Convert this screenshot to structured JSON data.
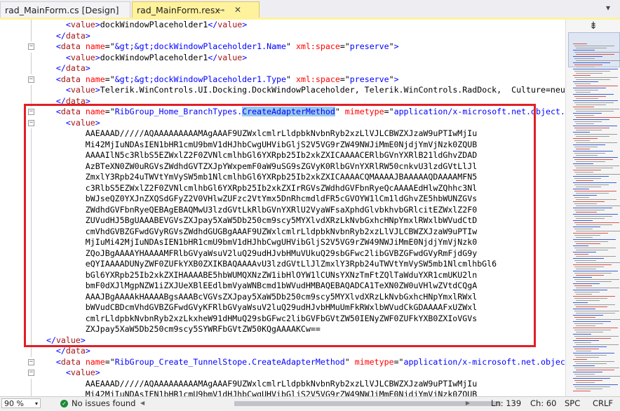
{
  "tabs": [
    {
      "label": "rad_MainForm.cs [Design]",
      "active": false
    },
    {
      "label": "rad_MainForm.resx",
      "active": true,
      "pin": "⊸",
      "close": "✕"
    }
  ],
  "tab_overflow": "▾",
  "colors": {
    "tag": "#0000ff",
    "element": "#a31515",
    "attr": "#ff0000",
    "text": "#000000",
    "highlight": "#e01f27",
    "selection": "#99c9ef",
    "active_tab": "#fff29d"
  },
  "code_lines": [
    {
      "fold": "line",
      "tokens": [
        {
          "t": "      ",
          "c": "k"
        },
        {
          "t": "<",
          "c": "b"
        },
        {
          "t": "value",
          "c": "r"
        },
        {
          "t": ">",
          "c": "b"
        },
        {
          "t": "dockWindowPlaceholder1",
          "c": "k"
        },
        {
          "t": "</",
          "c": "b"
        },
        {
          "t": "value",
          "c": "r"
        },
        {
          "t": ">",
          "c": "b"
        }
      ]
    },
    {
      "fold": "line",
      "tokens": [
        {
          "t": "    ",
          "c": "k"
        },
        {
          "t": "</",
          "c": "b"
        },
        {
          "t": "data",
          "c": "r"
        },
        {
          "t": ">",
          "c": "b"
        }
      ]
    },
    {
      "fold": "box",
      "tokens": [
        {
          "t": "    ",
          "c": "k"
        },
        {
          "t": "<",
          "c": "b"
        },
        {
          "t": "data",
          "c": "r"
        },
        {
          "t": " ",
          "c": "k"
        },
        {
          "t": "name",
          "c": "a"
        },
        {
          "t": "=\"",
          "c": "k"
        },
        {
          "t": "&gt;&gt;dockWindowPlaceholder1.Name",
          "c": "b"
        },
        {
          "t": "\"",
          "c": "k"
        },
        {
          "t": " ",
          "c": "k"
        },
        {
          "t": "xml:space",
          "c": "a"
        },
        {
          "t": "=\"",
          "c": "k"
        },
        {
          "t": "preserve",
          "c": "b"
        },
        {
          "t": "\"",
          "c": "k"
        },
        {
          "t": ">",
          "c": "b"
        }
      ]
    },
    {
      "fold": "line",
      "tokens": [
        {
          "t": "      ",
          "c": "k"
        },
        {
          "t": "<",
          "c": "b"
        },
        {
          "t": "value",
          "c": "r"
        },
        {
          "t": ">",
          "c": "b"
        },
        {
          "t": "dockWindowPlaceholder1",
          "c": "k"
        },
        {
          "t": "</",
          "c": "b"
        },
        {
          "t": "value",
          "c": "r"
        },
        {
          "t": ">",
          "c": "b"
        }
      ]
    },
    {
      "fold": "line",
      "tokens": [
        {
          "t": "    ",
          "c": "k"
        },
        {
          "t": "</",
          "c": "b"
        },
        {
          "t": "data",
          "c": "r"
        },
        {
          "t": ">",
          "c": "b"
        }
      ]
    },
    {
      "fold": "box",
      "tokens": [
        {
          "t": "    ",
          "c": "k"
        },
        {
          "t": "<",
          "c": "b"
        },
        {
          "t": "data",
          "c": "r"
        },
        {
          "t": " ",
          "c": "k"
        },
        {
          "t": "name",
          "c": "a"
        },
        {
          "t": "=\"",
          "c": "k"
        },
        {
          "t": "&gt;&gt;dockWindowPlaceholder1.Type",
          "c": "b"
        },
        {
          "t": "\"",
          "c": "k"
        },
        {
          "t": " ",
          "c": "k"
        },
        {
          "t": "xml:space",
          "c": "a"
        },
        {
          "t": "=\"",
          "c": "k"
        },
        {
          "t": "preserve",
          "c": "b"
        },
        {
          "t": "\"",
          "c": "k"
        },
        {
          "t": ">",
          "c": "b"
        }
      ]
    },
    {
      "fold": "line",
      "tokens": [
        {
          "t": "      ",
          "c": "k"
        },
        {
          "t": "<",
          "c": "b"
        },
        {
          "t": "value",
          "c": "r"
        },
        {
          "t": ">",
          "c": "b"
        },
        {
          "t": "Telerik.WinControls.UI.Docking.DockWindowPlaceholder, Telerik.WinControls.RadDock,  Culture=neutral",
          "c": "k"
        }
      ]
    },
    {
      "fold": "line",
      "tokens": [
        {
          "t": "    ",
          "c": "k"
        },
        {
          "t": "</",
          "c": "b"
        },
        {
          "t": "data",
          "c": "r"
        },
        {
          "t": ">",
          "c": "b"
        }
      ]
    },
    {
      "fold": "box",
      "tokens": [
        {
          "t": "    ",
          "c": "k"
        },
        {
          "t": "<",
          "c": "b"
        },
        {
          "t": "data",
          "c": "r"
        },
        {
          "t": " ",
          "c": "k"
        },
        {
          "t": "name",
          "c": "a"
        },
        {
          "t": "=\"",
          "c": "k"
        },
        {
          "t": "RibGroup_Home_BranchTypes.",
          "c": "b"
        },
        {
          "t": "CreateAdapterMethod",
          "c": "b",
          "sel": true
        },
        {
          "t": "\"",
          "c": "k"
        },
        {
          "t": " ",
          "c": "k"
        },
        {
          "t": "mimetype",
          "c": "a"
        },
        {
          "t": "=\"",
          "c": "k"
        },
        {
          "t": "application/x-microsoft.net.object.bina",
          "c": "b"
        }
      ]
    },
    {
      "fold": "box",
      "tokens": [
        {
          "t": "      ",
          "c": "k"
        },
        {
          "t": "<",
          "c": "b"
        },
        {
          "t": "value",
          "c": "r"
        },
        {
          "t": ">",
          "c": "b"
        }
      ]
    },
    {
      "fold": "line",
      "tokens": [
        {
          "t": "          AAEAAAD/////AQAAAAAAAAAMAgAAAF9UZWxlcmlrLldpbkNvbnRyb2xzLlVJLCBWZXJzaW9uPTIwMjIu",
          "c": "k"
        }
      ]
    },
    {
      "fold": "line",
      "tokens": [
        {
          "t": "          Mi42MjIuNDAsIEN1bHR1cmU9bmV1dHJhbCwgUHVibGljS2V5VG9rZW49NWJiMmE0NjdjYmVjNzk0ZQUB",
          "c": "k"
        }
      ]
    },
    {
      "fold": "line",
      "tokens": [
        {
          "t": "          AAAAIlN5c3RlbS5EZWxlZ2F0ZVNlcmlhbGl6YXRpb25Ib2xkZXICAAAACERlbGVnYXRlB21ldGhvZDAD",
          "c": "k"
        }
      ]
    },
    {
      "fold": "line",
      "tokens": [
        {
          "t": "          AzBTeXN0ZW0uRGVsZWdhdGVTZXJpYWxpemF0aW9uSG9sZGVyK0RlbGVnYXRlRW50cnkvU3lzdGVtLlJl",
          "c": "k"
        }
      ]
    },
    {
      "fold": "line",
      "tokens": [
        {
          "t": "          ZmxlY3Rpb24uTWVtYmVySW5mb1NlcmlhbGl6YXRpb25Ib2xkZXICAAAACQMAAAAJBAAAAAQDAAAAMFN5",
          "c": "k"
        }
      ]
    },
    {
      "fold": "line",
      "tokens": [
        {
          "t": "          c3RlbS5EZWxlZ2F0ZVNlcmlhbGl6YXRpb25Ib2xkZXIrRGVsZWdhdGVFbnRyeQcAAAAEdHlwZQhhc3Nl",
          "c": "k"
        }
      ]
    },
    {
      "fold": "line",
      "tokens": [
        {
          "t": "          bWJseQZ0YXJnZXQSdGFyZ2V0VHlwZUFzc2VtYmx5DnRhcmdldFR5cGVOYW1lCm1ldGhvZE5hbWUNZGVs",
          "c": "k"
        }
      ]
    },
    {
      "fold": "line",
      "tokens": [
        {
          "t": "          ZWdhdGVFbnRyeQEBAgEBAQMwU3lzdGVtLkRlbGVnYXRlU2VyaWFsaXphdGlvbkhvbGRlcitEZWxlZ2F0",
          "c": "k"
        }
      ]
    },
    {
      "fold": "line",
      "tokens": [
        {
          "t": "          ZUVudHJ5BgUAAABEVGVsZXJpay5XaW5Db250cm9scy5MYXlvdXRzLkNvbGxhcHNpYmxlRWxlbWVudCtD",
          "c": "k"
        }
      ]
    },
    {
      "fold": "line",
      "tokens": [
        {
          "t": "          cmVhdGVBZGFwdGVyRGVsZWdhdGUGBgAAAF9UZWxlcmlrLldpbkNvbnRyb2xzLlVJLCBWZXJzaW9uPTIw",
          "c": "k"
        }
      ]
    },
    {
      "fold": "line",
      "tokens": [
        {
          "t": "          MjIuMi42MjIuNDAsIEN1bHR1cmU9bmV1dHJhbCwgUHVibGljS2V5VG9rZW49NWJiMmE0NjdjYmVjNzk0",
          "c": "k"
        }
      ]
    },
    {
      "fold": "line",
      "tokens": [
        {
          "t": "          ZQoJBgAAAAYHAAAAMFRlbGVyaWsuV2luQ29udHJvbHMuVUkuQ29sbGFwc2libGVBZGFwdGVyRmFjdG9y",
          "c": "k"
        }
      ]
    },
    {
      "fold": "line",
      "tokens": [
        {
          "t": "          eQYIAAAADUNyZWF0ZUFkYXB0ZXIKBAQAAAAvU3lzdGVtLlJlZmxlY3Rpb24uTWVtYmVySW5mb1NlcmlhbGl6",
          "c": "k"
        }
      ]
    },
    {
      "fold": "line",
      "tokens": [
        {
          "t": "          bGl6YXRpb25Ib2xkZXIHAAAABE5hbWUMQXNzZW1ibHlOYW1lCUNsYXNzTmFtZQlTaWduYXR1cmUKU2ln",
          "c": "k"
        }
      ]
    },
    {
      "fold": "line",
      "tokens": [
        {
          "t": "          bmF0dXJlMgpNZW1iZXJUeXBlEEdlbmVyaWNBcmd1bWVudHMBAQEBAQADCA1TeXN0ZW0uVHlwZVtdCQgA",
          "c": "k"
        }
      ]
    },
    {
      "fold": "line",
      "tokens": [
        {
          "t": "          AAAJBgAAAAkHAAAABgsAAABcVGVsZXJpay5XaW5Db250cm9scy5MYXlvdXRzLkNvbGxhcHNpYmxlRWxl",
          "c": "k"
        }
      ]
    },
    {
      "fold": "line",
      "tokens": [
        {
          "t": "          bWVudCBDcmVhdGVBZGFwdGVyKFRlbGVyaWsuV2luQ29udHJvbHMuUmFkRWxlbWVudCkGDAAAAFxUZWxl",
          "c": "k"
        }
      ]
    },
    {
      "fold": "line",
      "tokens": [
        {
          "t": "          cmlrLldpbkNvbnRyb2xzLkxheW91dHMuQ29sbGFwc2libGVFbGVtZW50IENyZWF0ZUFkYXB0ZXIoVGVs",
          "c": "k"
        }
      ]
    },
    {
      "fold": "line",
      "tokens": [
        {
          "t": "          ZXJpay5XaW5Db250cm9scy5SYWRFbGVtZW50KQgAAAAKCw==",
          "c": "k"
        }
      ]
    },
    {
      "fold": "line",
      "tokens": [
        {
          "t": "  ",
          "c": "k"
        },
        {
          "t": "</",
          "c": "b"
        },
        {
          "t": "value",
          "c": "r"
        },
        {
          "t": ">",
          "c": "b"
        }
      ]
    },
    {
      "fold": "line",
      "tokens": [
        {
          "t": "    ",
          "c": "k"
        },
        {
          "t": "</",
          "c": "b"
        },
        {
          "t": "data",
          "c": "r"
        },
        {
          "t": ">",
          "c": "b"
        }
      ]
    },
    {
      "fold": "box",
      "tokens": [
        {
          "t": "    ",
          "c": "k"
        },
        {
          "t": "<",
          "c": "b"
        },
        {
          "t": "data",
          "c": "r"
        },
        {
          "t": " ",
          "c": "k"
        },
        {
          "t": "name",
          "c": "a"
        },
        {
          "t": "=\"",
          "c": "k"
        },
        {
          "t": "RibGroup_Create_TunnelStope.CreateAdapterMethod",
          "c": "b"
        },
        {
          "t": "\"",
          "c": "k"
        },
        {
          "t": " ",
          "c": "k"
        },
        {
          "t": "mimetype",
          "c": "a"
        },
        {
          "t": "=\"",
          "c": "k"
        },
        {
          "t": "application/x-microsoft.net.object.bi",
          "c": "b"
        }
      ]
    },
    {
      "fold": "box",
      "tokens": [
        {
          "t": "      ",
          "c": "k"
        },
        {
          "t": "<",
          "c": "b"
        },
        {
          "t": "value",
          "c": "r"
        },
        {
          "t": ">",
          "c": "b"
        }
      ]
    },
    {
      "fold": "line",
      "tokens": [
        {
          "t": "          AAEAAAD/////AQAAAAAAAAAMAgAAAF9UZWxlcmlrLldpbkNvbnRyb2xzLlVJLCBWZXJzaW9uPTIwMjIu",
          "c": "k"
        }
      ]
    },
    {
      "fold": "line",
      "tokens": [
        {
          "t": "          Mi42MjIuNDAsIEN1bHR1cmU9bmV1dHJhbCwgUHVibGljS2V5VG9rZW49NWJiMmE0NjdjYmVjNzk0ZQUB",
          "c": "k"
        }
      ]
    }
  ],
  "status": {
    "zoom": "90 %",
    "zoom_arrow": "▾",
    "issues_icon": "✓",
    "issues": "No issues found",
    "scroll_left": "◀",
    "scroll_right": "▶",
    "ln": "Ln: 139",
    "ch": "Ch: 60",
    "spc": "SPC",
    "crlf": "CRLF"
  },
  "vscroll": {
    "split_icon": "⇟"
  }
}
